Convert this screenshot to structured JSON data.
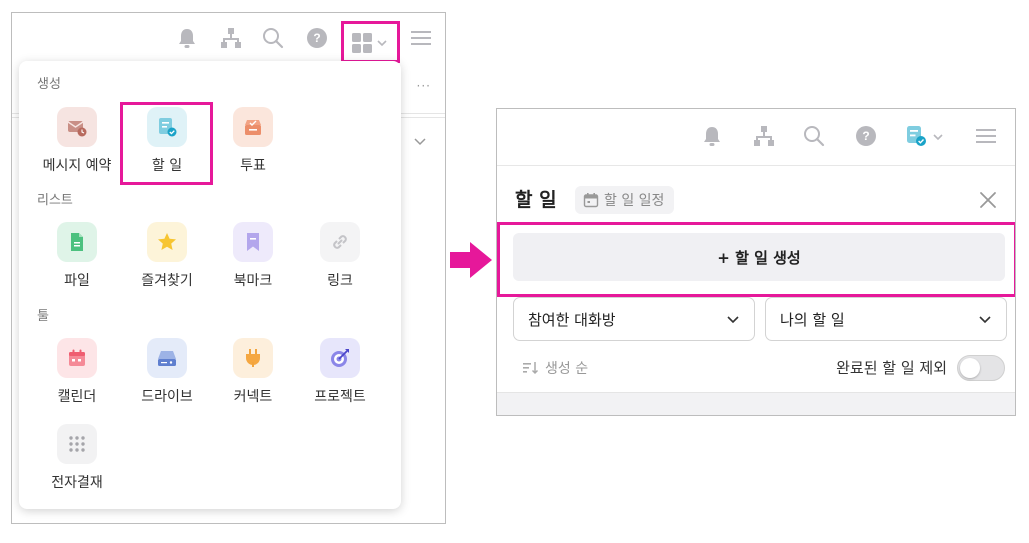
{
  "menu": {
    "sections": [
      {
        "title": "생성",
        "items": [
          "메시지 예약",
          "할 일",
          "투표"
        ]
      },
      {
        "title": "리스트",
        "items": [
          "파일",
          "즐겨찾기",
          "북마크",
          "링크"
        ]
      },
      {
        "title": "툴",
        "items": [
          "캘린더",
          "드라이브",
          "커넥트",
          "프로젝트",
          "전자결재"
        ]
      }
    ]
  },
  "left_bg": {
    "more": "···"
  },
  "panel": {
    "title": "할 일",
    "schedule_chip": "할 일 일정",
    "create_button": "+ 할 일 생성",
    "filter_room": "참여한 대화방",
    "filter_owner": "나의 할 일",
    "sort_label": "생성 순",
    "exclude_completed_label": "완료된 할 일 제외",
    "exclude_completed_on": false
  },
  "colors": {
    "highlight": "#e6189a",
    "arrow": "#e6189a",
    "topbar_icon": "#b8b8bd",
    "todo_accent": "#1aa3c8"
  },
  "icons": {
    "topbar": [
      "bell-icon",
      "org-chart-icon",
      "search-icon",
      "help-icon",
      "apps-grid-icon",
      "chevron-down-icon",
      "hamburger-menu-icon"
    ]
  }
}
